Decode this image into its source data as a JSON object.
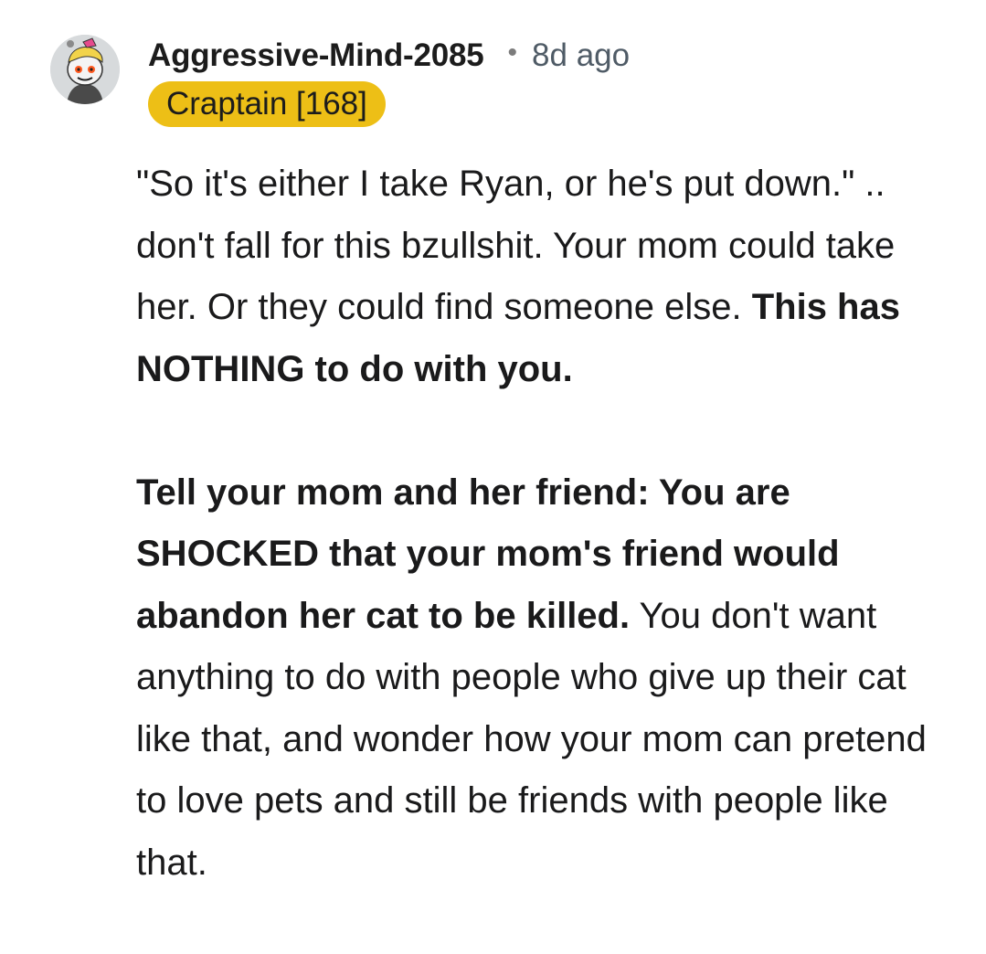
{
  "comment": {
    "author": "Aggressive-Mind-2085",
    "separator": "•",
    "timestamp": "8d ago",
    "flair": "Craptain [168]",
    "avatar_icon": "snoo-avatar-icon",
    "paragraphs": [
      {
        "segments": [
          {
            "text": "\"So it's either I take Ryan, or he's put down.\" .. don't fall for this bzullshit. Your mom could take her. Or they could find someone else. ",
            "bold": false
          },
          {
            "text": "This has NOTHING to do with you.",
            "bold": true
          }
        ]
      },
      {
        "segments": [
          {
            "text": "Tell your mom and her friend: You are SHOCKED that your mom's friend would abandon her cat to be killed.",
            "bold": true
          },
          {
            "text": " You don't want anything to do with people who give up their cat like that, and wonder how your mom can pretend to love pets and still be friends with people like that.",
            "bold": false
          }
        ]
      }
    ]
  },
  "colors": {
    "flair_background": "#edbf16",
    "text": "#1a1a1b",
    "meta": "#4f5b66"
  }
}
